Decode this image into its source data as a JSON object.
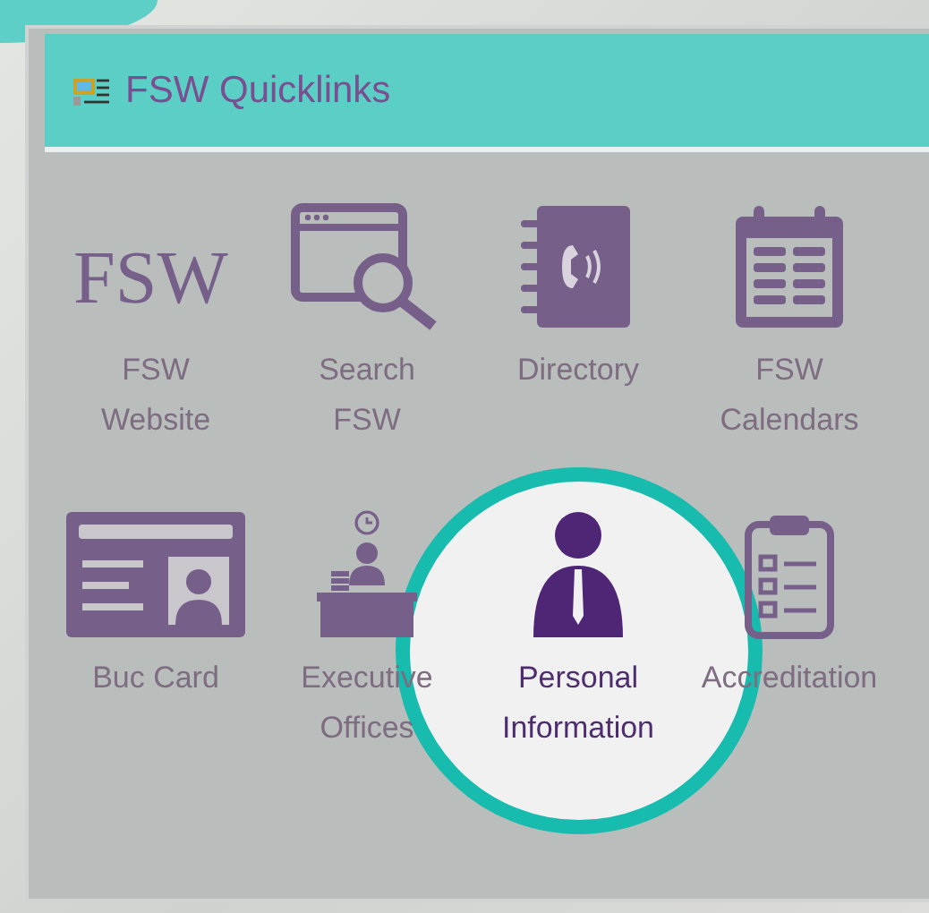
{
  "panel": {
    "title": "FSW Quicklinks"
  },
  "links": [
    {
      "kind": "logo",
      "logo_text": "FSW",
      "label": "FSW Website",
      "highlighted": false
    },
    {
      "kind": "search",
      "label": "Search FSW",
      "highlighted": false
    },
    {
      "kind": "directory",
      "label": "Directory",
      "highlighted": false
    },
    {
      "kind": "calendar",
      "label": "FSW Calendars",
      "highlighted": false
    },
    {
      "kind": "idcard",
      "label": "Buc Card",
      "highlighted": false
    },
    {
      "kind": "desk",
      "label": "Executive Offices",
      "highlighted": false
    },
    {
      "kind": "person",
      "label": "Personal Information",
      "highlighted": true
    },
    {
      "kind": "clipboard",
      "label": "Accreditation",
      "highlighted": false
    }
  ]
}
